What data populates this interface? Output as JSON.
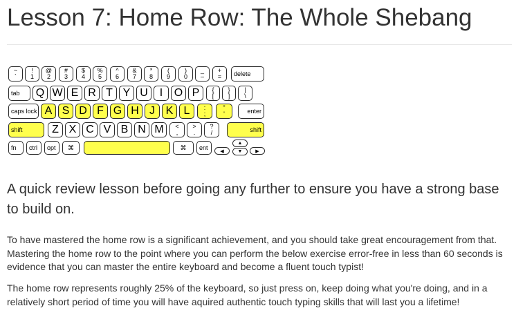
{
  "lesson": {
    "title": "Lesson 7: Home Row: The Whole Shebang",
    "subtitle": "A quick review lesson before going any further to ensure you have a strong base to build on.",
    "paragraphs": [
      "To have mastered the home row is a significant achievement, and you should take great encouragement from that. Mastering the home row to the point where you can perform the below exercise error-free in less than 60 seconds is evidence that you can master the entire keyboard and become a fluent touch typist!",
      "The home row represents roughly 25% of the keyboard, so just press on, keep doing what you're doing, and in a relatively short period of time you will have aquired authentic touch typing skills that will last you a lifetime!"
    ]
  },
  "keyboard": {
    "highlight_color": "#ffff4d",
    "rows": [
      [
        {
          "top": "~",
          "bottom": "`"
        },
        {
          "top": "!",
          "bottom": "1"
        },
        {
          "top": "@",
          "bottom": "2"
        },
        {
          "top": "#",
          "bottom": "3"
        },
        {
          "top": "$",
          "bottom": "4"
        },
        {
          "top": "%",
          "bottom": "5"
        },
        {
          "top": "^",
          "bottom": "6"
        },
        {
          "top": "&",
          "bottom": "7"
        },
        {
          "top": "*",
          "bottom": "8"
        },
        {
          "top": "(",
          "bottom": "9"
        },
        {
          "top": ")",
          "bottom": "0"
        },
        {
          "top": "_",
          "bottom": "–"
        },
        {
          "top": "+",
          "bottom": "="
        },
        {
          "label": "delete"
        }
      ],
      [
        {
          "label": "tab"
        },
        {
          "label": "Q"
        },
        {
          "label": "W"
        },
        {
          "label": "E"
        },
        {
          "label": "R"
        },
        {
          "label": "T"
        },
        {
          "label": "Y"
        },
        {
          "label": "U"
        },
        {
          "label": "I"
        },
        {
          "label": "O"
        },
        {
          "label": "P"
        },
        {
          "top": "{",
          "bottom": "["
        },
        {
          "top": "}",
          "bottom": "]"
        },
        {
          "top": "|",
          "bottom": "\\"
        }
      ],
      [
        {
          "label": "caps lock"
        },
        {
          "label": "A",
          "hl": true
        },
        {
          "label": "S",
          "hl": true
        },
        {
          "label": "D",
          "hl": true
        },
        {
          "label": "F",
          "hl": true
        },
        {
          "label": "G",
          "hl": true
        },
        {
          "label": "H",
          "hl": true
        },
        {
          "label": "J",
          "hl": true
        },
        {
          "label": "K",
          "hl": true
        },
        {
          "label": "L",
          "hl": true
        },
        {
          "top": ":",
          "bottom": ";",
          "hl": true
        },
        {
          "top": "\"",
          "bottom": "'",
          "hl": true
        },
        {
          "label": "enter"
        }
      ],
      [
        {
          "label": "shift",
          "hl": true
        },
        {
          "label": "Z"
        },
        {
          "label": "X"
        },
        {
          "label": "C"
        },
        {
          "label": "V"
        },
        {
          "label": "B"
        },
        {
          "label": "N"
        },
        {
          "label": "M"
        },
        {
          "top": "<",
          "bottom": ","
        },
        {
          "top": ">",
          "bottom": "."
        },
        {
          "top": "?",
          "bottom": "/"
        },
        {
          "label": "shift",
          "hl": true
        }
      ],
      [
        {
          "label": "fn"
        },
        {
          "label": "ctrl"
        },
        {
          "label": "opt"
        },
        {
          "label": "⌘"
        },
        {
          "label": "",
          "hl": true
        },
        {
          "label": "⌘"
        },
        {
          "label": "ent"
        },
        {
          "label": "◀"
        },
        {
          "label": "▲"
        },
        {
          "label": "▼"
        },
        {
          "label": "▶"
        }
      ]
    ]
  }
}
